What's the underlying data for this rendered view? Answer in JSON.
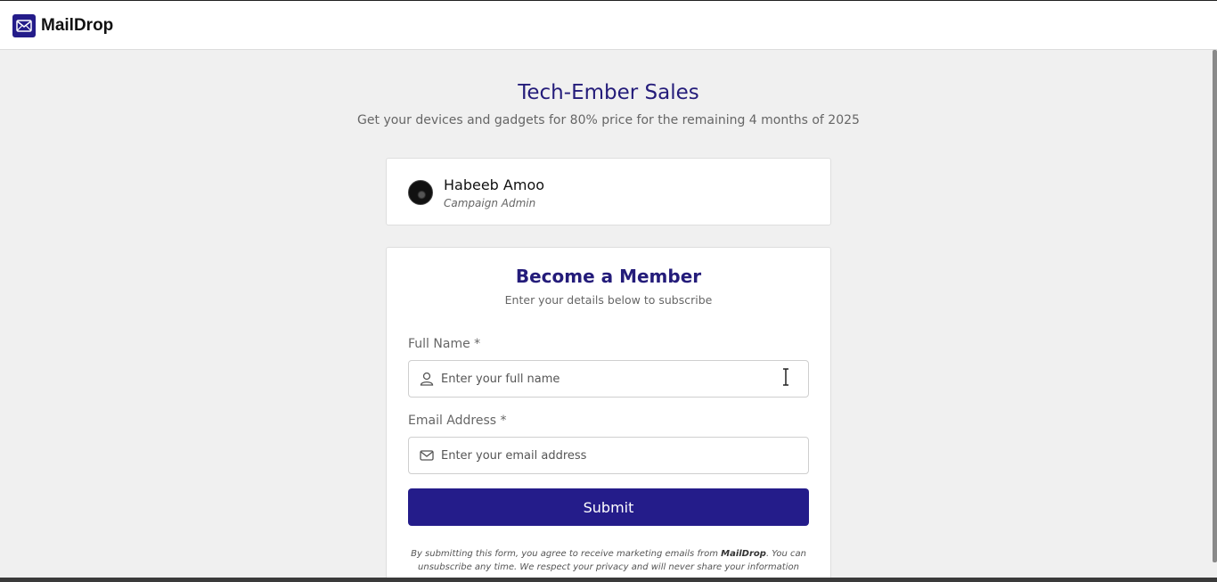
{
  "brand": {
    "name": "MailDrop",
    "icon": "envelope-icon",
    "color": "#241c8a"
  },
  "hero": {
    "title": "Tech-Ember Sales",
    "subtitle": "Get your devices and gadgets for 80% price for the remaining 4 months of 2025"
  },
  "admin": {
    "name": "Habeeb Amoo",
    "role": "Campaign Admin"
  },
  "form": {
    "title": "Become a Member",
    "subtitle": "Enter your details below to subscribe",
    "fullname_label": "Full Name *",
    "fullname_placeholder": "Enter your full name",
    "fullname_value": "",
    "email_label": "Email Address *",
    "email_placeholder": "Enter your email address",
    "email_value": "",
    "submit_label": "Submit",
    "disclaimer_prefix": "By submitting this form, you agree to receive marketing emails from ",
    "disclaimer_brand": "MailDrop",
    "disclaimer_suffix": ". You can unsubscribe any time. We respect your privacy and will never share your information"
  },
  "colors": {
    "accent": "#241c8a",
    "title": "#241c7a",
    "background": "#f0f0f0"
  }
}
